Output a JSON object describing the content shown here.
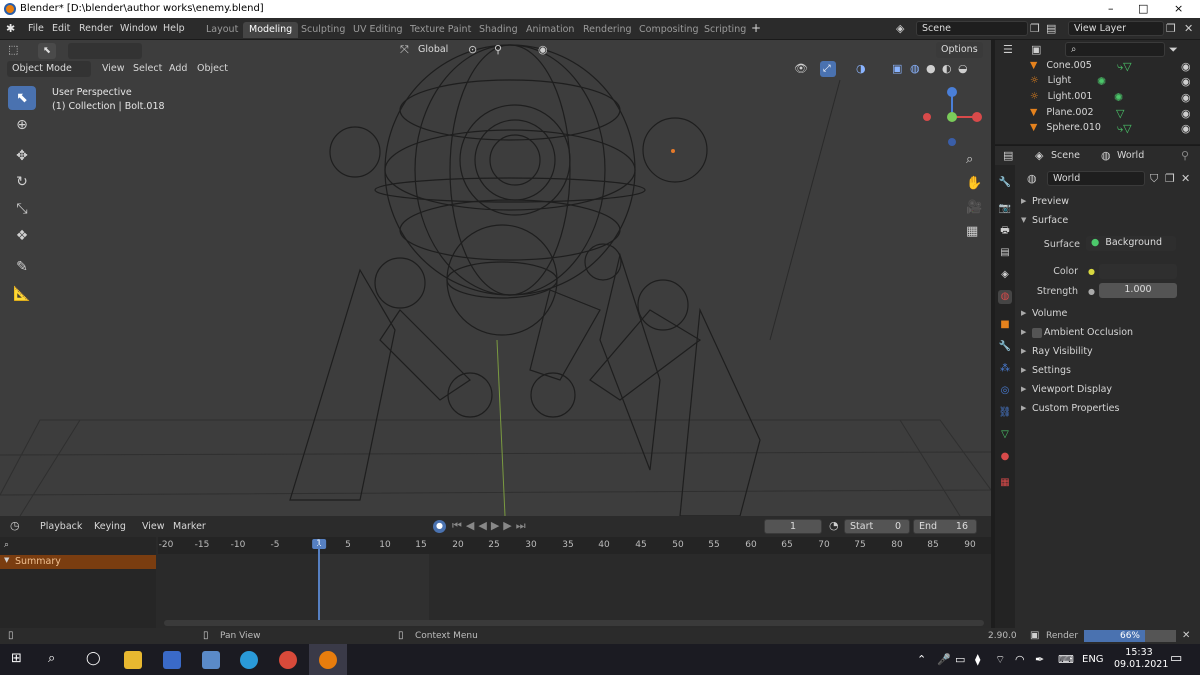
{
  "window": {
    "title": "Blender* [D:\\blender\\author works\\enemy.blend]",
    "controls": [
      "–",
      "□",
      "×"
    ]
  },
  "menubar": {
    "menus": [
      "File",
      "Edit",
      "Render",
      "Window",
      "Help"
    ],
    "workspaces": [
      "Layout",
      "Modeling",
      "Sculpting",
      "UV Editing",
      "Texture Paint",
      "Shading",
      "Animation",
      "Rendering",
      "Compositing",
      "Scripting"
    ],
    "active_workspace": "Modeling",
    "add_tab": "+",
    "scene_name": "Scene",
    "view_layer": "View Layer"
  },
  "viewport_header": {
    "orientation": "Global",
    "options_label": "Options",
    "mode": "Object Mode",
    "menus": [
      "View",
      "Select",
      "Add",
      "Object"
    ]
  },
  "viewport": {
    "perspective_label": "User Perspective",
    "collection_label": "(1) Collection | Bolt.018",
    "background_color": "#3d3d3d"
  },
  "outliner": {
    "items": [
      {
        "name": "Cone.005",
        "icon": "cone-triangle-icon"
      },
      {
        "name": "Light",
        "icon": "light-bulb-icon"
      },
      {
        "name": "Light.001",
        "icon": "light-bulb-icon"
      },
      {
        "name": "Plane.002",
        "icon": "mesh-triangle-icon"
      },
      {
        "name": "Sphere.010",
        "icon": "mesh-triangle-icon"
      }
    ]
  },
  "properties": {
    "breadcrumb_scene": "Scene",
    "breadcrumb_world": "World",
    "world_name": "World",
    "panels": {
      "preview": "Preview",
      "surface": "Surface",
      "volume": "Volume",
      "ambient_occlusion": "Ambient Occlusion",
      "ray_visibility": "Ray Visibility",
      "settings": "Settings",
      "viewport_display": "Viewport Display",
      "custom_properties": "Custom Properties"
    },
    "surface_label": "Surface",
    "surface_value": "Background",
    "color_label": "Color",
    "strength_label": "Strength",
    "strength_value": "1.000"
  },
  "timeline": {
    "menus": [
      "Playback",
      "Keying",
      "View",
      "Marker"
    ],
    "current_frame": "1",
    "start_label": "Start",
    "start_value": "0",
    "end_label": "End",
    "end_value": "16",
    "ruler_ticks": [
      "-20",
      "-15",
      "-10",
      "-5",
      "1",
      "5",
      "10",
      "15",
      "20",
      "25",
      "30",
      "35",
      "40",
      "45",
      "50",
      "55",
      "60",
      "65",
      "70",
      "75",
      "80",
      "85",
      "90"
    ],
    "summary_label": "Summary"
  },
  "statusbar": {
    "pan_view": "Pan View",
    "context_menu": "Context Menu",
    "version": "2.90.0",
    "render_label": "Render",
    "render_progress_text": "66%",
    "render_progress": 0.66
  },
  "taskbar": {
    "language": "ENG",
    "time": "15:33",
    "date": "09.01.2021"
  },
  "colors": {
    "accent_blue": "#4a72b0",
    "summary_orange": "#7a3d10",
    "playhead_blue": "#5680c2",
    "object_orange": "#e5821d",
    "data_green": "#4cc86b"
  }
}
